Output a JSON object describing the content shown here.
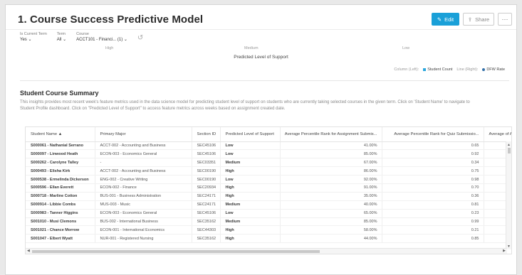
{
  "header": {
    "title": "1. Course Success Predictive Model",
    "edit_label": "Edit",
    "share_label": "Share",
    "more_label": "···"
  },
  "filters": [
    {
      "label": "Is Current Term",
      "value": "Yes ⌄"
    },
    {
      "label": "Term",
      "value": "All ⌄"
    },
    {
      "label": "Course",
      "value": "ACCT101 - Financi...  (1) ⌄"
    }
  ],
  "chart_fragment": {
    "ticks": [
      "High",
      "Medium",
      "Low"
    ],
    "xlabel": "Predicted Level of Support"
  },
  "legend": {
    "col_left": "Column (Left):",
    "student_count": "Student Count",
    "line_right": "Line (Right):",
    "dfw_rate": "DFW Rate",
    "colors": {
      "student_count": "#2aa6dd",
      "dfw_rate": "#3370a8"
    }
  },
  "section": {
    "title": "Student Course Summary",
    "description": "This insights provides most recent week's feature metrics used in the data science model for predicting student level of support on students who are currently taking selected courses in the given term. Click on 'Student Name' to navigate to Student Profile dashboard. Click on \"Predicted Level of Support\" to access feature metrics across weeks based on assignment created date."
  },
  "table": {
    "columns": [
      "Student Name ▲",
      "Primary Major",
      "Section ID",
      "Predicted Level of Support",
      "Average Percentile Rank for Assignment Submis...",
      "Average Percentile Rank for Quiz Submissio...",
      "Average of A"
    ],
    "rows": [
      [
        "S000061 - Nathanial Serrano",
        "ACCT-002 - Accounting and Business",
        "SEC45106",
        "Low",
        "41.00%",
        "0.65"
      ],
      [
        "S000097 - Linwood Heath",
        "ECON-003 - Economics General",
        "SEC45106",
        "Low",
        "85.00%",
        "0.92"
      ],
      [
        "S000262 - Carolyne Talley",
        "-",
        "SEC03351",
        "Medium",
        "67.00%",
        "0.34"
      ],
      [
        "S000493 - Elisha Kirk",
        "ACCT-002 - Accounting and Business",
        "SEC00190",
        "High",
        "86.00%",
        "0.75"
      ],
      [
        "S000538 - Ermelinda Dickerson",
        "ENG-002 - Creative Writing",
        "SEC00190",
        "Low",
        "92.00%",
        "0.98"
      ],
      [
        "S000596 - Ellan Everett",
        "ECON-002 - Finance",
        "SEC20934",
        "High",
        "91.00%",
        "0.70"
      ],
      [
        "S000718 - Marline Cotton",
        "BUS-001 - Business Administration",
        "SEC24171",
        "High",
        "35.00%",
        "0.36"
      ],
      [
        "S000914 - Libbie Combs",
        "MUS-003 - Music",
        "SEC24171",
        "Medium",
        "40.00%",
        "0.81"
      ],
      [
        "S000983 - Tanner Higgins",
        "ECON-003 - Economics General",
        "SEC45106",
        "Low",
        "65.00%",
        "0.23"
      ],
      [
        "S001010 - Musi Clemons",
        "BUS-002 - International Business",
        "SEC35162",
        "Medium",
        "85.00%",
        "0.99"
      ],
      [
        "S001021 - Chance Morrow",
        "ECON-001 - International Economics",
        "SEC44303",
        "High",
        "58.00%",
        "0.21"
      ],
      [
        "S001047 - Elbert Wyatt",
        "NUR-001 - Registered Nursing",
        "SEC35162",
        "High",
        "44.00%",
        "0.85"
      ]
    ]
  }
}
